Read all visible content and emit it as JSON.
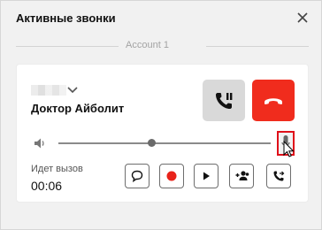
{
  "window": {
    "title": "Активные звонки",
    "close_icon": "close-icon"
  },
  "account": {
    "label": "Account 1"
  },
  "call": {
    "contact_name": "Доктор Айболит",
    "status": "Идет вызов",
    "duration": "00:06",
    "volume_level": 0.44
  },
  "colors": {
    "hangup": "#f02c1d",
    "hold_bg": "#d9d9d9",
    "mic_highlight": "#e0101a"
  },
  "controls": {
    "icons": [
      "chat-bubble-icon",
      "record-icon",
      "play-icon",
      "add-participant-icon",
      "transfer-call-icon"
    ]
  }
}
